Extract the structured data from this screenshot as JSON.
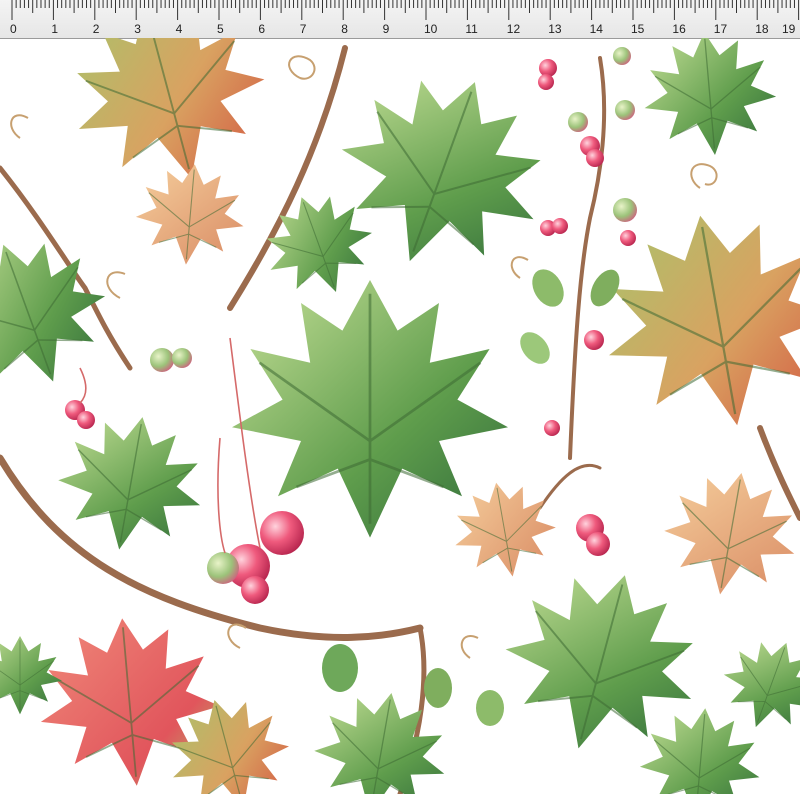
{
  "ruler": {
    "unit_labels": [
      "0",
      "1",
      "2",
      "3",
      "4",
      "5",
      "6",
      "7",
      "8",
      "9",
      "10",
      "11",
      "12",
      "13",
      "14",
      "15",
      "16",
      "17",
      "18",
      "19"
    ]
  },
  "pattern": {
    "colors": {
      "background": "#ffffff",
      "leaf_green": "#5e9a4a",
      "leaf_light": "#b9d78a",
      "leaf_autumn": "#e08a55",
      "leaf_red": "#e25c63",
      "vine": "#9a6a4c",
      "berry": "#e2466a"
    }
  }
}
